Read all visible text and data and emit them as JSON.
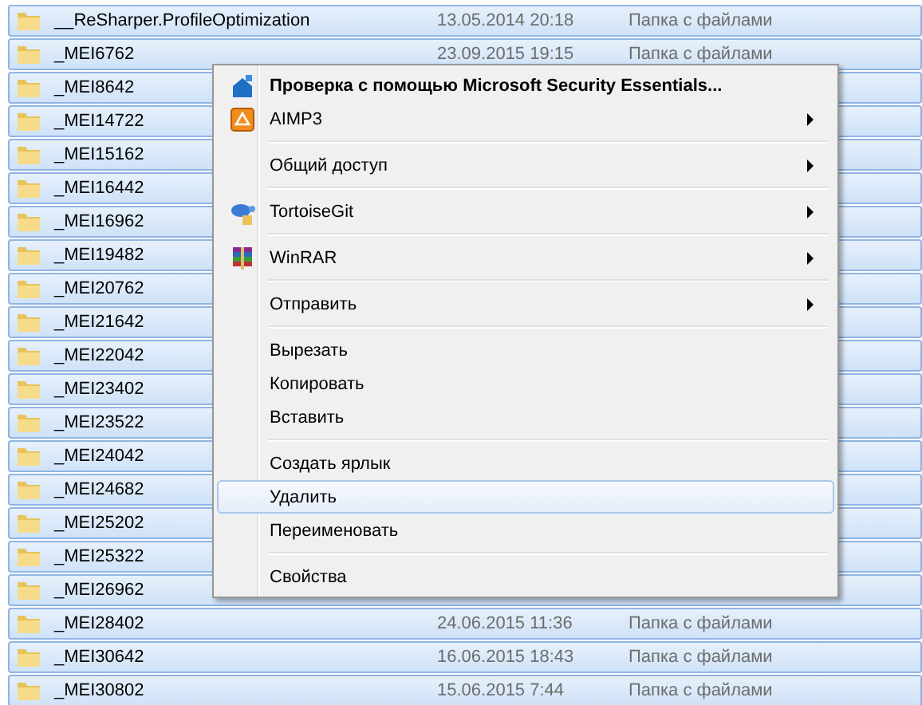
{
  "rows": [
    {
      "name": "__ReSharper.ProfileOptimization",
      "date": "13.05.2014 20:18",
      "type": "Папка с файлами",
      "selected": true
    },
    {
      "name": "_MEI6762",
      "date": "23.09.2015 19:15",
      "type": "Папка с файлами",
      "selected": true
    },
    {
      "name": "_MEI8642",
      "selected": true
    },
    {
      "name": "_MEI14722",
      "selected": true
    },
    {
      "name": "_MEI15162",
      "selected": true
    },
    {
      "name": "_MEI16442",
      "selected": true
    },
    {
      "name": "_MEI16962",
      "selected": true
    },
    {
      "name": "_MEI19482",
      "selected": true
    },
    {
      "name": "_MEI20762",
      "selected": true
    },
    {
      "name": "_MEI21642",
      "selected": true
    },
    {
      "name": "_MEI22042",
      "selected": true
    },
    {
      "name": "_MEI23402",
      "selected": true
    },
    {
      "name": "_MEI23522",
      "selected": true
    },
    {
      "name": "_MEI24042",
      "selected": true
    },
    {
      "name": "_MEI24682",
      "selected": true
    },
    {
      "name": "_MEI25202",
      "selected": true
    },
    {
      "name": "_MEI25322",
      "selected": true
    },
    {
      "name": "_MEI26962",
      "selected": true
    },
    {
      "name": "_MEI28402",
      "date": "24.06.2015 11:36",
      "type": "Папка с файлами",
      "selected": true
    },
    {
      "name": "_MEI30642",
      "date": "16.06.2015 18:43",
      "type": "Папка с файлами",
      "selected": true
    },
    {
      "name": "_MEI30802",
      "date": "15.06.2015 7:44",
      "type": "Папка с файлами",
      "selected": true
    }
  ],
  "context_menu": [
    {
      "kind": "item",
      "label": "Проверка с помощью Microsoft Security Essentials...",
      "bold": true,
      "submenu": false,
      "selected": false
    },
    {
      "kind": "item",
      "label": "AIMP3",
      "bold": false,
      "submenu": true,
      "selected": false
    },
    {
      "kind": "separator"
    },
    {
      "kind": "item",
      "label": "Общий доступ",
      "bold": false,
      "submenu": true,
      "selected": false
    },
    {
      "kind": "separator"
    },
    {
      "kind": "item",
      "label": "TortoiseGit",
      "bold": false,
      "submenu": true,
      "selected": false
    },
    {
      "kind": "separator"
    },
    {
      "kind": "item",
      "label": "WinRAR",
      "bold": false,
      "submenu": true,
      "selected": false
    },
    {
      "kind": "separator"
    },
    {
      "kind": "item",
      "label": "Отправить",
      "bold": false,
      "submenu": true,
      "selected": false
    },
    {
      "kind": "separator"
    },
    {
      "kind": "item",
      "label": "Вырезать",
      "bold": false,
      "submenu": false,
      "selected": false
    },
    {
      "kind": "item",
      "label": "Копировать",
      "bold": false,
      "submenu": false,
      "selected": false
    },
    {
      "kind": "item",
      "label": "Вставить",
      "bold": false,
      "submenu": false,
      "selected": false
    },
    {
      "kind": "separator"
    },
    {
      "kind": "item",
      "label": "Создать ярлык",
      "bold": false,
      "submenu": false,
      "selected": false
    },
    {
      "kind": "item",
      "label": "Удалить",
      "bold": false,
      "submenu": false,
      "selected": true
    },
    {
      "kind": "item",
      "label": "Переименовать",
      "bold": false,
      "submenu": false,
      "selected": false
    },
    {
      "kind": "separator"
    },
    {
      "kind": "item",
      "label": "Свойства",
      "bold": false,
      "submenu": false,
      "selected": false
    }
  ]
}
